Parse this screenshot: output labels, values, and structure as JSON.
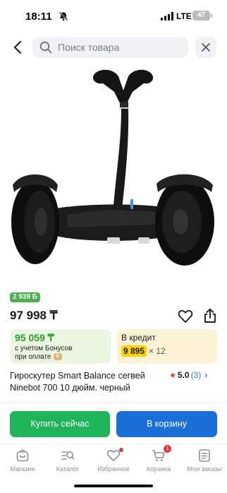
{
  "status_bar": {
    "time": "18:11",
    "network": "LTE",
    "battery": "47"
  },
  "search": {
    "placeholder": "Поиск товара"
  },
  "product": {
    "bonus_badge": "2 939 Б",
    "price": "97 998 ₸",
    "bonus_price": "95 059 ₸",
    "bonus_line1": "с учетом Бонусов",
    "bonus_line2": "при оплате",
    "bonus_coin": "Б",
    "credit_title": "В кредит",
    "credit_amount": "9 895",
    "credit_multiplier": "× 12",
    "title": "Гироскутер Smart Balance сегвей Ninebot 700 10 дюйм. черный",
    "rating_value": "5.0",
    "rating_count": "(3)",
    "rating_star": "★",
    "rating_chevron": "›"
  },
  "actions": {
    "buy_now": "Купить сейчас",
    "add_to_cart": "В корзину"
  },
  "bottom_nav": {
    "items": [
      {
        "label": "Магазин",
        "icon": "store-icon"
      },
      {
        "label": "Каталог",
        "icon": "catalog-search-icon"
      },
      {
        "label": "Избранное",
        "icon": "heart-icon"
      },
      {
        "label": "Корзина",
        "icon": "cart-icon",
        "badge": "1"
      },
      {
        "label": "Мои заказы",
        "icon": "orders-icon"
      }
    ]
  },
  "colors": {
    "buy_button": "#1fb35a",
    "cart_button": "#1d6fd8",
    "bonus_green": "#2e9a2e",
    "credit_yellow": "#ffd400",
    "accent_red": "#e5393c"
  }
}
